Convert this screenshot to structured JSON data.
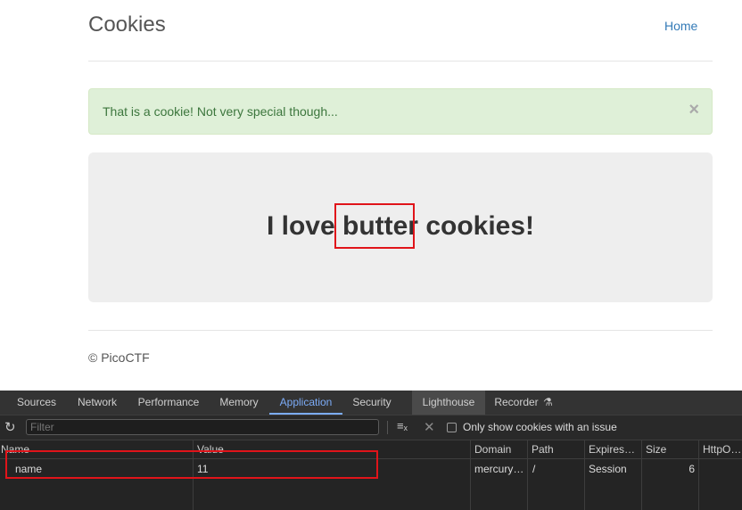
{
  "site": {
    "brand": "Cookies",
    "nav_home": "Home",
    "alert_text": "That is a cookie! Not very special though...",
    "alert_close": "×",
    "jumbo_text": "I love butter cookies!",
    "footer": "© PicoCTF"
  },
  "devtools": {
    "tabs": [
      "Sources",
      "Network",
      "Performance",
      "Memory",
      "Application",
      "Security",
      "Lighthouse",
      "Recorder"
    ],
    "active_tab": "Application",
    "filter_placeholder": "Filter",
    "only_issue_label": "Only show cookies with an issue",
    "columns": [
      "Name",
      "Value",
      "Domain",
      "Path",
      "Expires…",
      "Size",
      "HttpOnly"
    ],
    "row": {
      "name": "name",
      "value": "11",
      "domain": "mercury…",
      "path": "/",
      "expires": "Session",
      "size": "6"
    }
  },
  "colors": {
    "accent": "#7cacf8",
    "highlight": "#e0141a",
    "alert_bg": "#dff0d8"
  }
}
